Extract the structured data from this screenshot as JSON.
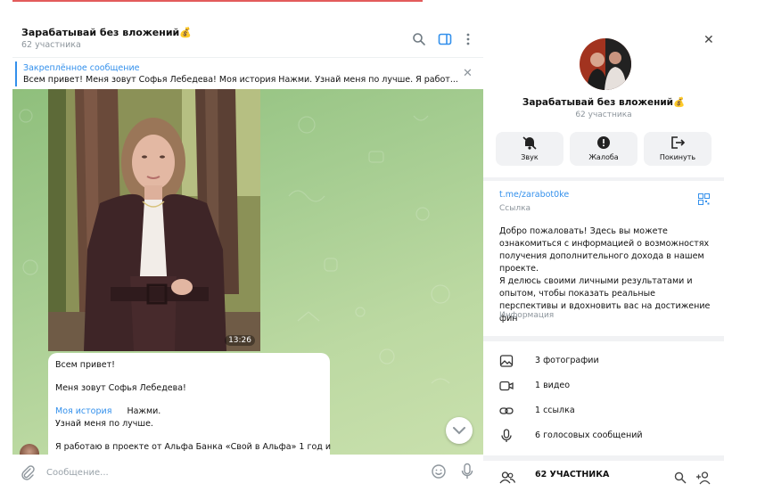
{
  "chat": {
    "title": "Зарабатывай без вложений💰",
    "subtitle": "62 участника",
    "pinned": {
      "title": "Закреплённое сообщение",
      "text": "Всем привет!  Меня зовут Софья Лебедева!  Моя история   Нажми.  Узнай меня по лучше.  Я работ..."
    },
    "photo_time": "13:26",
    "message": {
      "line1": "Всем привет!",
      "line2": "Меня зовут Софья Лебедева!",
      "link": "Моя история",
      "after_link": "Нажми.",
      "line4": "Узнай меня по лучше.",
      "line5": "Я работаю в проекте от Альфа Банка «Свой в Альфа» 1 год и"
    },
    "composer_placeholder": "Сообщение..."
  },
  "info": {
    "title": "Зарабатывай без вложений💰",
    "subtitle": "62 участника",
    "actions": [
      {
        "label": "Звук",
        "icon": "bell-off-icon"
      },
      {
        "label": "Жалоба",
        "icon": "alert-icon"
      },
      {
        "label": "Покинуть",
        "icon": "logout-icon"
      }
    ],
    "link_value": "t.me/zarabot0ke",
    "link_label": "Ссылка",
    "description": "Добро пожаловать! Здесь вы можете ознакомиться с информацией о возможностях получения дополнительного дохода в нашем проекте.\nЯ делюсь своими личными результатами и опытом, чтобы показать реальные перспективы и вдохновить вас на достижение фин",
    "description_label": "Информация",
    "media": [
      {
        "label": "3 фотографии",
        "icon": "photo-icon"
      },
      {
        "label": "1 видео",
        "icon": "video-icon"
      },
      {
        "label": "1 ссылка",
        "icon": "link-icon"
      },
      {
        "label": "6 голосовых сообщений",
        "icon": "microphone-icon"
      }
    ],
    "members_label": "62 УЧАСТНИКА"
  },
  "colors": {
    "accent": "#3390ec",
    "chat_bg": "#a4cc90",
    "muted_text": "#8d959c"
  }
}
